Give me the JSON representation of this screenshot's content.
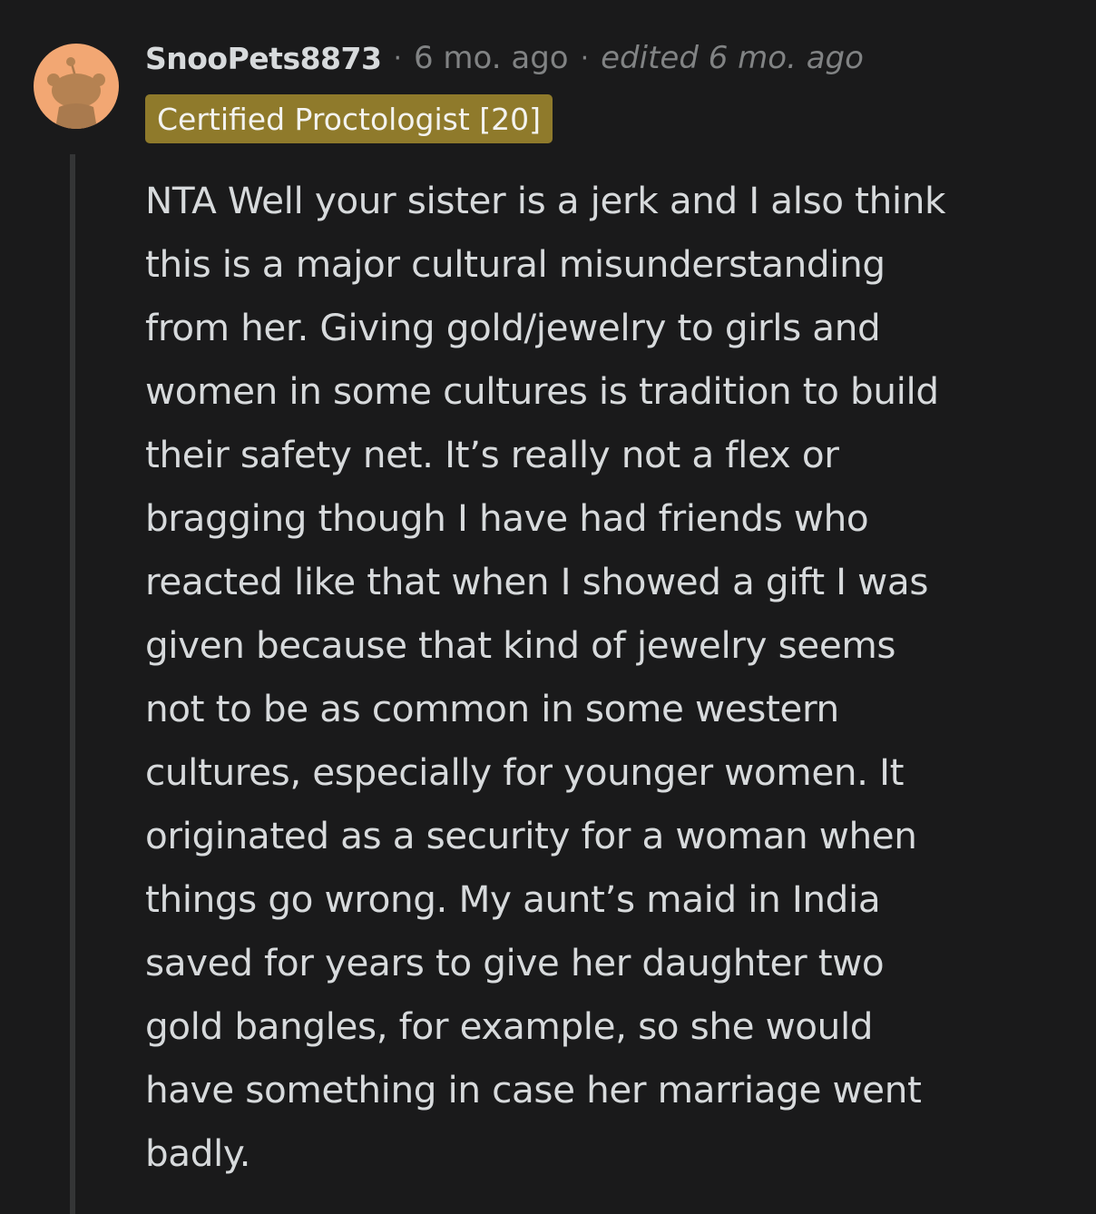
{
  "comment": {
    "username": "SnooPets8873",
    "separator": "·",
    "timestamp": "6 mo. ago",
    "edited": "edited 6 mo. ago",
    "flair": "Certified Proctologist [20]",
    "body": "NTA Well your sister is a jerk and I also think\nthis is a major cultural misunderstanding\nfrom her. Giving gold/jewelry to girls and\nwomen in some cultures is tradition to build\ntheir safety net. It’s really not a flex or\nbragging though I have had friends who\nreacted like that when I showed a gift I was\ngiven because that kind of jewelry seems\nnot to be as common in some western\ncultures, especially for younger women. It\noriginated as a security for a woman when\nthings go wrong. My aunt’s maid in India\nsaved for years to give her daughter two\ngold bangles, for example, so she would\nhave something in case her marriage went\nbadly."
  },
  "icons": {
    "avatar": "snoo-avatar-icon"
  },
  "colors": {
    "background": "#1a1a1b",
    "text": "#d7dadc",
    "meta": "#818384",
    "flair_bg": "#8f7a2b",
    "flair_text": "#f3f3f0",
    "avatar_bg": "#f2a773",
    "thread_line": "#343536"
  }
}
